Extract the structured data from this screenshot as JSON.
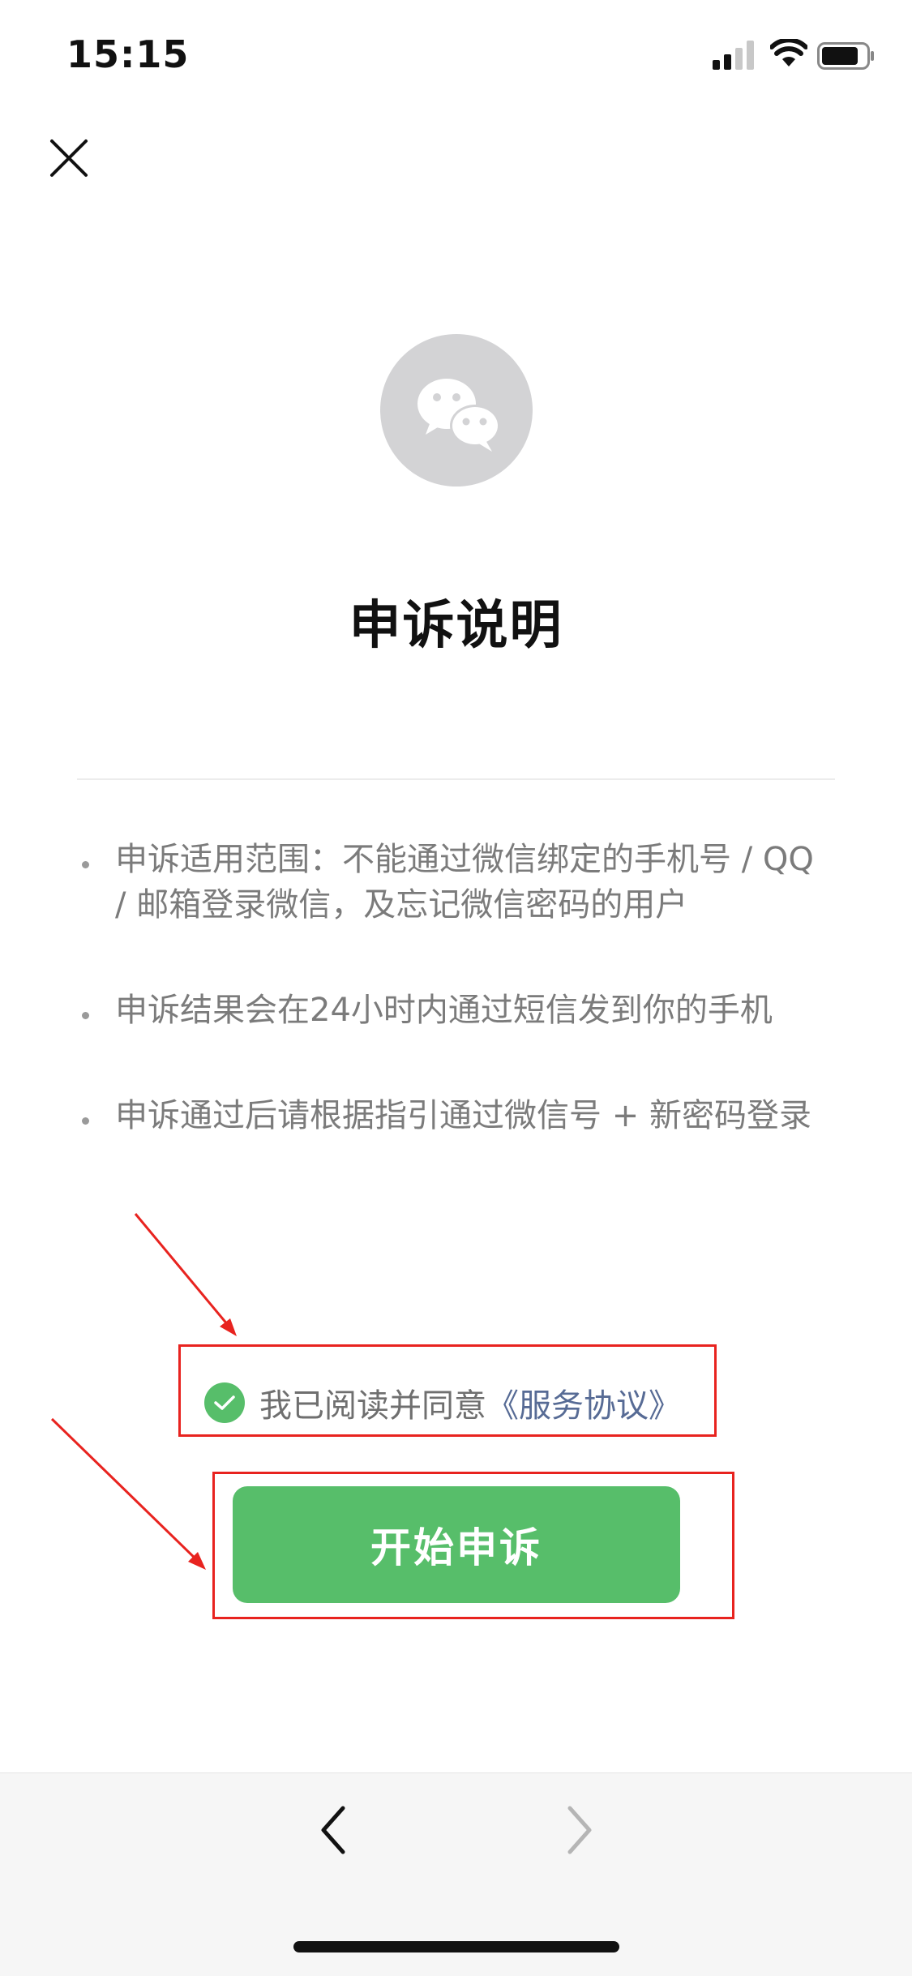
{
  "status_bar": {
    "time": "15:15"
  },
  "header": {
    "close_icon": "close-icon"
  },
  "logo": {
    "icon": "wechat-logo-icon",
    "color": "#d3d3d5"
  },
  "title": "申诉说明",
  "bullets": [
    "申诉适用范围：不能通过微信绑定的手机号 / QQ / 邮箱登录微信，及忘记微信密码的用户",
    "申诉结果会在24小时内通过短信发到你的手机",
    "申诉通过后请根据指引通过微信号 + 新密码登录"
  ],
  "agreement": {
    "checked": true,
    "text": "我已阅读并同意",
    "link": "《服务协议》"
  },
  "primary_button": {
    "label": "开始申诉",
    "color": "#57be6a"
  },
  "annotation_color": "#e8231f",
  "bottom_nav": {
    "back_icon": "chevron-left-icon",
    "forward_icon": "chevron-right-icon"
  }
}
